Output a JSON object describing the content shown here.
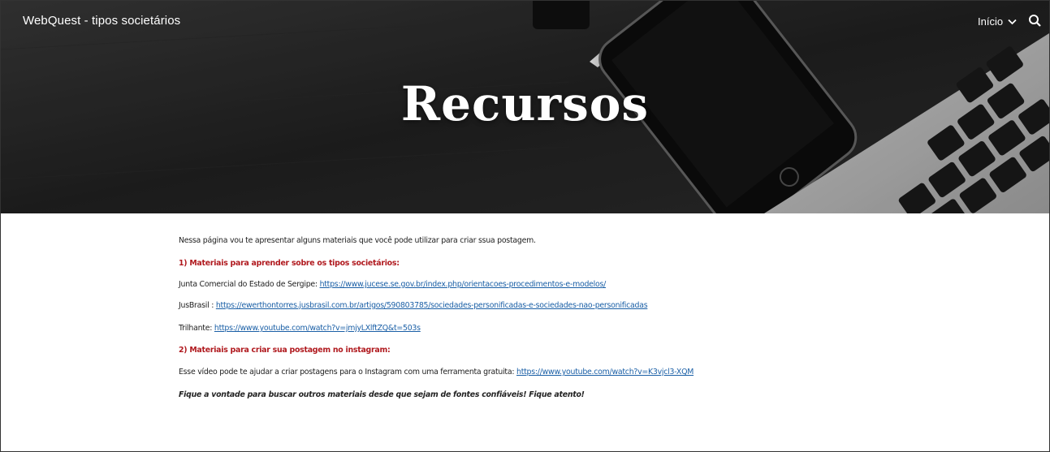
{
  "header": {
    "site_title": "WebQuest - tipos societários",
    "nav_item": "Início",
    "page_title": "Recursos"
  },
  "content": {
    "intro": "Nessa página vou te apresentar alguns materiais que você pode utilizar para criar ssua postagem.",
    "section1_heading": "1) Materiais para aprender sobre os tipos societários:",
    "item1_label": "Junta Comercial do Estado de Sergipe:  ",
    "item1_link": "https://www.jucese.se.gov.br/index.php/orientacoes-procedimentos-e-modelos/",
    "item2_label": "JusBrasil : ",
    "item2_link": "https://ewerthontorres.jusbrasil.com.br/artigos/590803785/sociedades-personificadas-e-sociedades-nao-personificadas",
    "item3_label": "Trilhante: ",
    "item3_link": "https://www.youtube.com/watch?v=jmjyLXlftZQ&t=503s",
    "section2_heading": "2) Materiais para criar sua postagem no instagram:",
    "item4_label": "Esse vídeo pode te ajudar a criar postagens para o Instagram com uma ferramenta gratuita: ",
    "item4_link": "https://www.youtube.com/watch?v=K3vjcl3-XQM",
    "closing": "Fique a vontade para buscar outros materiais desde que sejam de fontes confiáveis! Fique atento!"
  },
  "colors": {
    "heading_red": "#b0191e",
    "link_blue": "#1a5fa6",
    "hero_dark": "#1d1d1d"
  },
  "icons": [
    "chevron-down-icon",
    "search-icon"
  ]
}
